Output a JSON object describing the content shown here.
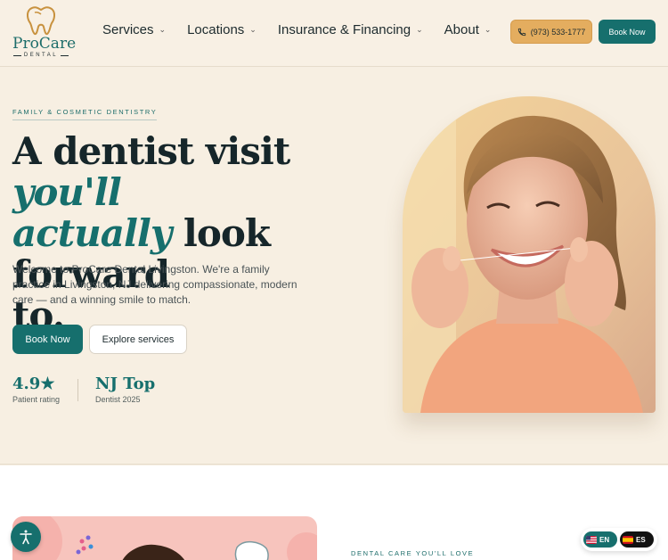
{
  "brand": {
    "name": "ProCare",
    "sub": "DENTAL"
  },
  "nav": {
    "items": [
      {
        "label": "Services"
      },
      {
        "label": "Locations"
      },
      {
        "label": "Insurance & Financing"
      },
      {
        "label": "About"
      }
    ],
    "chevron_icon": "chevron-down-icon"
  },
  "header": {
    "phone": "(973) 533-1777",
    "phone_icon": "phone-icon",
    "book_label": "Book Now"
  },
  "hero": {
    "eyebrow": "FAMILY & COSMETIC DENTISTRY",
    "headline_1": "A dentist visit ",
    "headline_accent_1": "you'll",
    "headline_accent_2": "actually",
    "headline_2": " look forward",
    "headline_3": "to.",
    "intro": "Welcome to ProCare Dental Livingston. We're a family practice in Livingston, NJ delivering compassionate, modern care — and a winning smile to match.",
    "book_label": "Book Now",
    "explore_label": "Explore services",
    "stats": [
      {
        "value": "4.9★",
        "label": "Patient rating"
      },
      {
        "value": "NJ Top",
        "label": "Dentist 2025"
      }
    ]
  },
  "lower": {
    "eyebrow": "DENTAL CARE YOU'LL LOVE"
  },
  "language": {
    "options": [
      {
        "code": "EN"
      },
      {
        "code": "ES"
      }
    ]
  },
  "colors": {
    "teal": "#166f6d",
    "gold": "#e4ad5f",
    "cream": "#f7efe2",
    "dark": "#16262a"
  }
}
